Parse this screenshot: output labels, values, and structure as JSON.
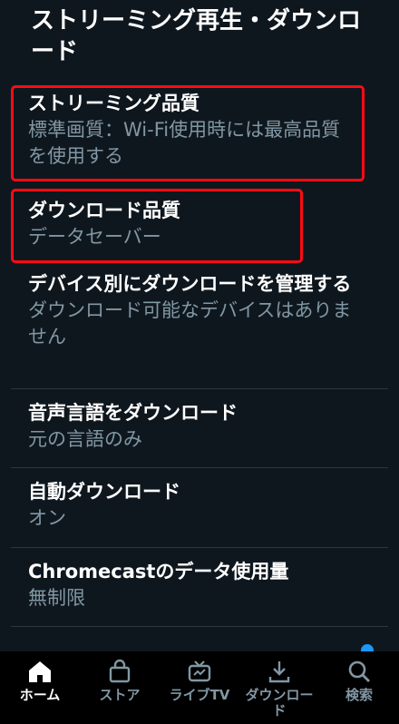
{
  "header": {
    "title": "ストリーミング再生・ダウンロード"
  },
  "settings": [
    {
      "label": "ストリーミング品質",
      "value": "標準画質：Wi-Fi使用時には最高品質を使用する"
    },
    {
      "label": "ダウンロード品質",
      "value": "データセーバー"
    },
    {
      "label": "デバイス別にダウンロードを管理する",
      "value": "ダウンロード可能なデバイスはありません"
    },
    {
      "label": "音声言語をダウンロード",
      "value": "元の言語のみ"
    },
    {
      "label": "自動ダウンロード",
      "value": "オン"
    },
    {
      "label": "Chromecastのデータ使用量",
      "value": "無制限"
    }
  ],
  "highlight_color": "#ff0b14",
  "accent_color": "#1a98ff",
  "nav": {
    "active_index": 0,
    "items": [
      {
        "label": "ホーム",
        "icon": "home-icon"
      },
      {
        "label": "ストア",
        "icon": "store-bag-icon"
      },
      {
        "label": "ライブTV",
        "icon": "tv-icon"
      },
      {
        "label": "ダウンロード",
        "icon": "download-icon"
      },
      {
        "label": "検索",
        "icon": "search-icon"
      }
    ]
  }
}
